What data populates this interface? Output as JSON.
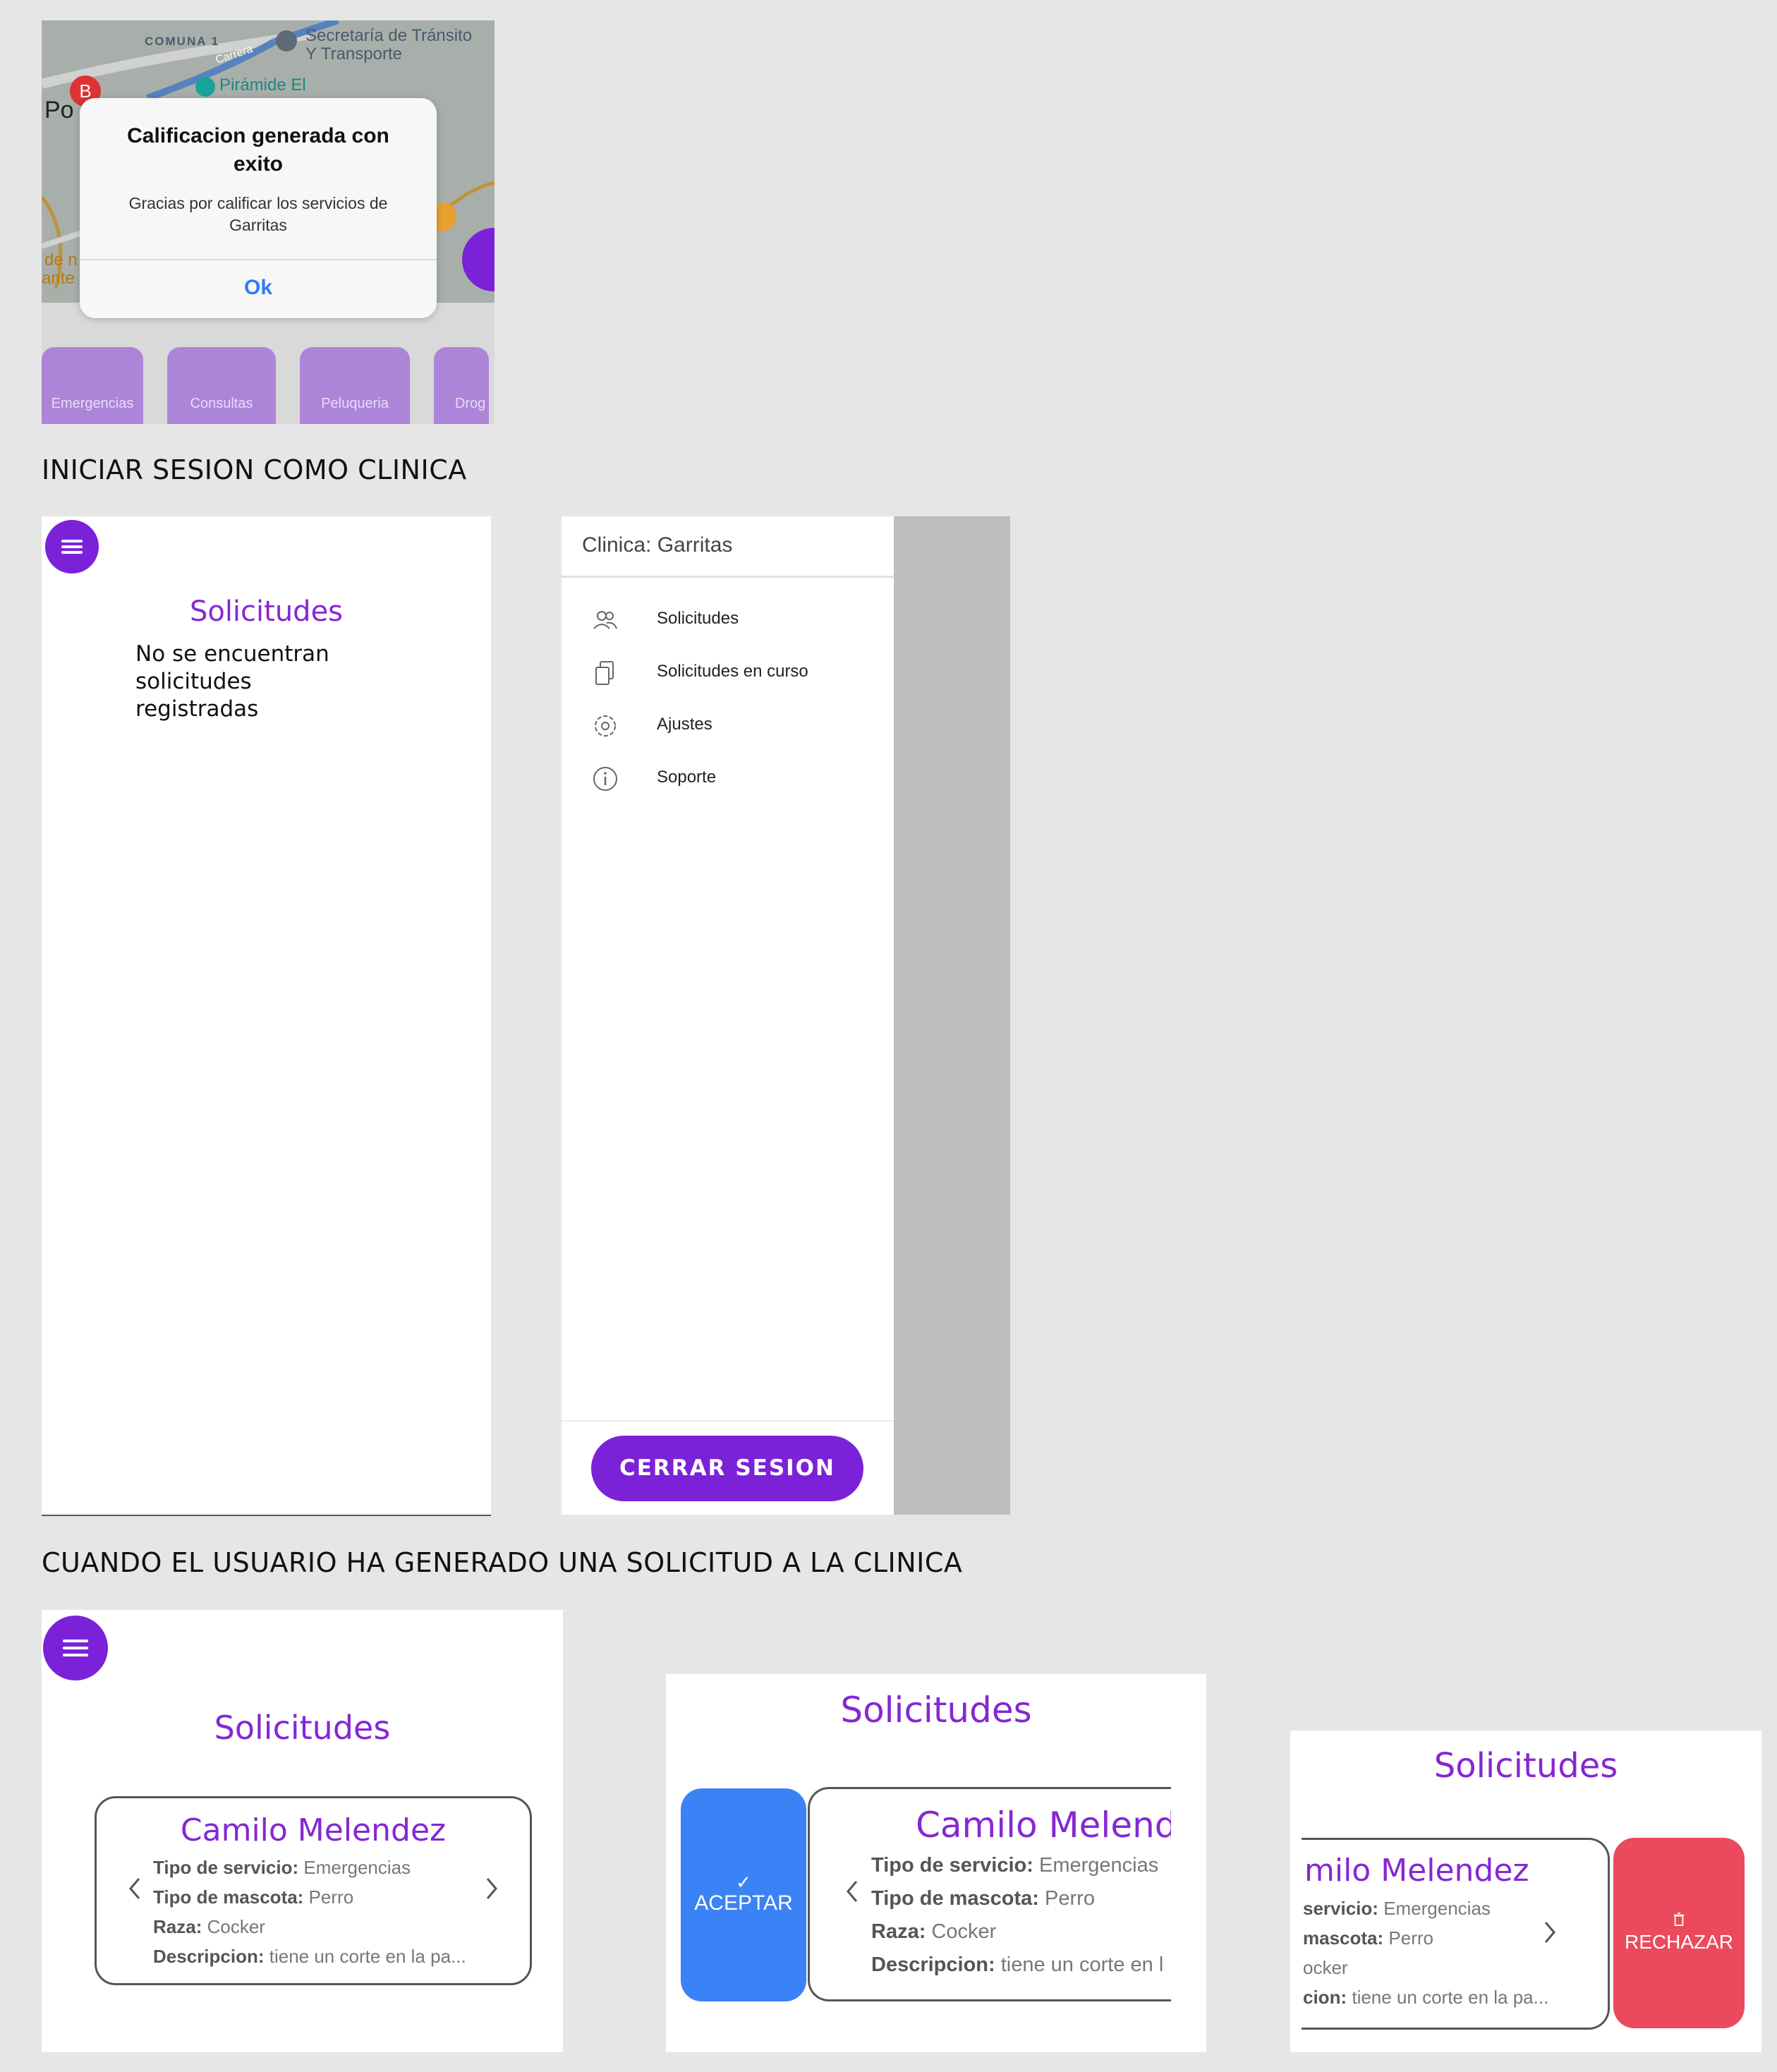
{
  "headings": {
    "clinic_login": "INICIAR SESION COMO CLINICA",
    "user_request": "CUANDO EL USUARIO HA GENERADO UNA SOLICITUD A LA CLINICA"
  },
  "map_screen": {
    "labels": {
      "comuna": "COMUNA 1",
      "carrera": "Carrera",
      "transito_1": "Secretaría de Tránsito",
      "transito_2": "Y Transporte",
      "piramide": "Pirámide El",
      "po": "Po",
      "de_n": "de n",
      "ante": "ante",
      "marker_b": "B"
    },
    "dialog": {
      "title": "Calificacion generada con exito",
      "message": "Gracias por calificar los servicios de Garritas",
      "ok": "Ok"
    },
    "categories": [
      "Emergencias",
      "Consultas",
      "Peluqueria",
      "Drog"
    ]
  },
  "solicitudes_empty": {
    "title": "Solicitudes",
    "message": "No se encuentran solicitudes registradas"
  },
  "drawer": {
    "header": "Clinica: Garritas",
    "items": [
      {
        "label": "Solicitudes",
        "icon": "users-icon"
      },
      {
        "label": "Solicitudes en curso",
        "icon": "documents-icon"
      },
      {
        "label": "Ajustes",
        "icon": "gear-icon"
      },
      {
        "label": "Soporte",
        "icon": "info-icon"
      }
    ],
    "logout": "CERRAR SESION"
  },
  "request_card": {
    "title": "Solicitudes",
    "name": "Camilo Melendez",
    "rows": [
      {
        "label": "Tipo de servicio:",
        "value": "Emergencias"
      },
      {
        "label": "Tipo de mascota:",
        "value": "Perro"
      },
      {
        "label": "Raza:",
        "value": "Cocker"
      },
      {
        "label": "Descripcion:",
        "value": "tiene un corte en la pa..."
      }
    ]
  },
  "swipe_accept": {
    "title": "Solicitudes",
    "button": "ACEPTAR",
    "name_cut": "Camilo Melende",
    "desc_cut": "tiene un corte en l"
  },
  "swipe_reject": {
    "title": "Solicitudes",
    "button": "RECHAZAR",
    "name_cut": "milo Melendez",
    "row_labels_cut": [
      "servicio:",
      "mascota:",
      "",
      "cion:"
    ],
    "row_values_cut": [
      "Emergencias",
      "Perro",
      "ocker",
      "tiene un corte en la pa..."
    ]
  },
  "colors": {
    "purple": "#7b22d8",
    "title_purple": "#8527d3",
    "accept_blue": "#3b82f6",
    "reject_red": "#ea4a5c",
    "ok_blue": "#2f7cf6"
  }
}
